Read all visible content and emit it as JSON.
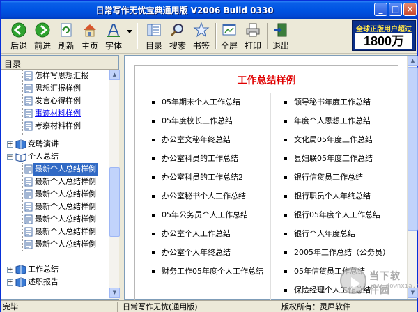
{
  "window": {
    "title": "日常写作无忧宝典通用版 V2006 Build 0330"
  },
  "toolbar": {
    "back": "后退",
    "forward": "前进",
    "refresh": "刷新",
    "home": "主页",
    "font": "字体",
    "contents": "目录",
    "search": "搜索",
    "bookmark": "书签",
    "fullscreen": "全屏",
    "print": "打印",
    "exit": "退出"
  },
  "ad": {
    "line1": "全球正版用户超过",
    "line2": "1800万"
  },
  "sidebar": {
    "header": "目录",
    "nodes": [
      {
        "label": "怎样写思想汇报"
      },
      {
        "label": "思想汇报样例"
      },
      {
        "label": "发言心得样例"
      },
      {
        "label": "事迹材料样例"
      },
      {
        "label": "考察材料样例"
      },
      {
        "label": "竞聘演讲"
      },
      {
        "label": "个人总结"
      },
      {
        "label": "最新个人总结样例"
      },
      {
        "label": "最新个人总结样例"
      },
      {
        "label": "最新个人总结样例"
      },
      {
        "label": "最新个人总结样例"
      },
      {
        "label": "最新个人总结样例"
      },
      {
        "label": "最新个人总结样例"
      },
      {
        "label": "最新个人总结样例"
      },
      {
        "label": "工作总结"
      },
      {
        "label": "述职报告"
      }
    ]
  },
  "content": {
    "title": "工作总结样例",
    "left": [
      "05年期末个人工作总结",
      "05年度校长工作总结",
      "办公室文秘年终总结",
      "办公室科员的工作总结",
      "办公室科员的工作总结2",
      "办公室秘书个人工作总结",
      "05年公务员个人工作总结",
      "办公室个人工作总结",
      "办公室个人年终总结",
      "财务工作05年度个人工作总结"
    ],
    "right": [
      "领导秘书年度工作总结",
      "年度个人思想工作总结",
      "文化局05年度工作总结",
      "县妇联05年度工作总结",
      "银行信贷员工作总结",
      "银行职员个人年终总结",
      "银行05年度个人工作总结",
      "银行个人年度总结",
      "2005年工作总结（公务员）",
      "05年信贷员工作总结",
      "保险经理个人工作总结"
    ]
  },
  "status": {
    "left": "完毕",
    "middle": "日常写作无忧(通用版)",
    "right": "版权所有：灵犀软件"
  },
  "watermark": {
    "text": "当下软件园",
    "url": "www.downxia.com"
  }
}
